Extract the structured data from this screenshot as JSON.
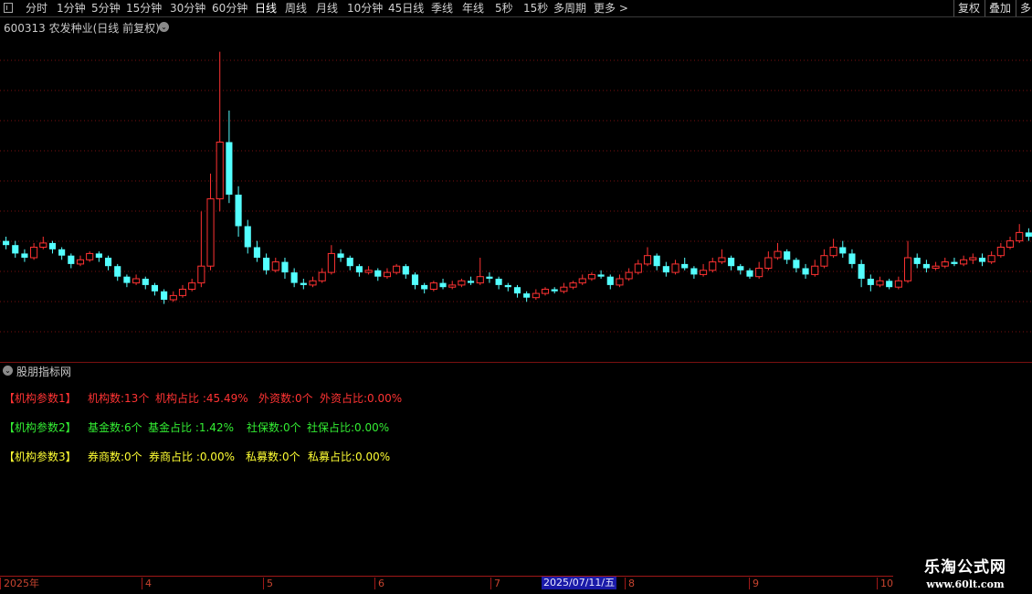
{
  "toolbar": {
    "periods": [
      "分时",
      "1分钟",
      "5分钟",
      "15分钟",
      "30分钟",
      "60分钟",
      "日线",
      "周线",
      "月线",
      "10分钟",
      "45日线",
      "季线",
      "年线",
      "5秒",
      "15秒",
      "多周期",
      "更多 >"
    ],
    "active_period": "日线",
    "right_buttons": [
      "复权",
      "叠加",
      "多"
    ]
  },
  "main_chart": {
    "title": "600313 农发种业(日线 前复权)",
    "colors": {
      "up": "#ff3232",
      "down": "#54ffff",
      "grid": "#7a1010"
    }
  },
  "indicator": {
    "title": "股朋指标网",
    "rows": [
      {
        "color": "#ff3333",
        "items": [
          "【机构参数1】",
          "机构数:13个",
          "机构占比 :45.49%",
          "外资数:0个",
          "外资占比:0.00%"
        ]
      },
      {
        "color": "#33ee33",
        "items": [
          "【机构参数2】",
          "基金数:6个",
          "基金占比 :1.42%",
          "社保数:0个",
          "社保占比:0.00%"
        ]
      },
      {
        "color": "#ffff33",
        "items": [
          "【机构参数3】",
          "券商数:0个",
          "券商占比 :0.00%",
          "私募数:0个",
          "私募占比:0.00%"
        ]
      }
    ]
  },
  "time_axis": {
    "labels": [
      "2025年",
      "4",
      "5",
      "6",
      "7",
      "8",
      "9",
      "10"
    ],
    "current": "2025/07/11/五"
  },
  "watermark": {
    "title": "乐淘公式网",
    "url": "www.60lt.com"
  },
  "chart_data": {
    "type": "candlestick",
    "title": "600313 农发种业(日线 前复权)",
    "candles": [
      [
        0.48,
        0.46,
        0.5,
        0.44
      ],
      [
        0.46,
        0.42,
        0.48,
        0.4
      ],
      [
        0.42,
        0.4,
        0.44,
        0.38
      ],
      [
        0.4,
        0.45,
        0.47,
        0.39
      ],
      [
        0.45,
        0.47,
        0.5,
        0.44
      ],
      [
        0.47,
        0.44,
        0.48,
        0.42
      ],
      [
        0.44,
        0.41,
        0.45,
        0.39
      ],
      [
        0.41,
        0.37,
        0.42,
        0.35
      ],
      [
        0.37,
        0.39,
        0.41,
        0.36
      ],
      [
        0.39,
        0.42,
        0.43,
        0.38
      ],
      [
        0.42,
        0.4,
        0.43,
        0.38
      ],
      [
        0.4,
        0.36,
        0.41,
        0.34
      ],
      [
        0.36,
        0.31,
        0.37,
        0.29
      ],
      [
        0.31,
        0.28,
        0.32,
        0.26
      ],
      [
        0.28,
        0.3,
        0.32,
        0.27
      ],
      [
        0.3,
        0.27,
        0.31,
        0.25
      ],
      [
        0.27,
        0.24,
        0.28,
        0.22
      ],
      [
        0.24,
        0.2,
        0.25,
        0.18
      ],
      [
        0.2,
        0.22,
        0.24,
        0.19
      ],
      [
        0.22,
        0.25,
        0.27,
        0.21
      ],
      [
        0.25,
        0.28,
        0.3,
        0.24
      ],
      [
        0.28,
        0.36,
        0.62,
        0.26
      ],
      [
        0.36,
        0.68,
        0.8,
        0.34
      ],
      [
        0.68,
        0.95,
        1.38,
        0.62
      ],
      [
        0.95,
        0.7,
        1.1,
        0.66
      ],
      [
        0.7,
        0.55,
        0.74,
        0.5
      ],
      [
        0.55,
        0.45,
        0.58,
        0.42
      ],
      [
        0.45,
        0.4,
        0.48,
        0.38
      ],
      [
        0.4,
        0.34,
        0.42,
        0.32
      ],
      [
        0.34,
        0.38,
        0.4,
        0.33
      ],
      [
        0.38,
        0.33,
        0.4,
        0.3
      ],
      [
        0.33,
        0.28,
        0.35,
        0.26
      ],
      [
        0.28,
        0.27,
        0.3,
        0.25
      ],
      [
        0.27,
        0.29,
        0.31,
        0.26
      ],
      [
        0.29,
        0.33,
        0.35,
        0.28
      ],
      [
        0.33,
        0.42,
        0.46,
        0.32
      ],
      [
        0.42,
        0.4,
        0.44,
        0.38
      ],
      [
        0.4,
        0.36,
        0.41,
        0.34
      ],
      [
        0.36,
        0.33,
        0.37,
        0.31
      ],
      [
        0.33,
        0.34,
        0.36,
        0.32
      ],
      [
        0.34,
        0.31,
        0.35,
        0.29
      ],
      [
        0.31,
        0.33,
        0.35,
        0.3
      ],
      [
        0.33,
        0.36,
        0.37,
        0.32
      ],
      [
        0.36,
        0.32,
        0.37,
        0.3
      ],
      [
        0.32,
        0.27,
        0.33,
        0.25
      ],
      [
        0.27,
        0.25,
        0.28,
        0.23
      ],
      [
        0.25,
        0.28,
        0.29,
        0.24
      ],
      [
        0.28,
        0.26,
        0.3,
        0.25
      ],
      [
        0.26,
        0.27,
        0.29,
        0.25
      ],
      [
        0.27,
        0.29,
        0.3,
        0.26
      ],
      [
        0.29,
        0.28,
        0.31,
        0.27
      ],
      [
        0.28,
        0.31,
        0.4,
        0.27
      ],
      [
        0.31,
        0.3,
        0.33,
        0.28
      ],
      [
        0.3,
        0.27,
        0.31,
        0.25
      ],
      [
        0.27,
        0.26,
        0.28,
        0.24
      ],
      [
        0.26,
        0.23,
        0.27,
        0.21
      ],
      [
        0.23,
        0.21,
        0.24,
        0.19
      ],
      [
        0.21,
        0.23,
        0.25,
        0.2
      ],
      [
        0.23,
        0.25,
        0.26,
        0.22
      ],
      [
        0.25,
        0.24,
        0.26,
        0.23
      ],
      [
        0.24,
        0.26,
        0.28,
        0.23
      ],
      [
        0.26,
        0.28,
        0.29,
        0.25
      ],
      [
        0.28,
        0.3,
        0.32,
        0.27
      ],
      [
        0.3,
        0.32,
        0.33,
        0.29
      ],
      [
        0.32,
        0.31,
        0.34,
        0.3
      ],
      [
        0.31,
        0.27,
        0.32,
        0.25
      ],
      [
        0.27,
        0.3,
        0.32,
        0.26
      ],
      [
        0.3,
        0.33,
        0.35,
        0.29
      ],
      [
        0.33,
        0.37,
        0.39,
        0.32
      ],
      [
        0.37,
        0.41,
        0.45,
        0.36
      ],
      [
        0.41,
        0.36,
        0.42,
        0.34
      ],
      [
        0.36,
        0.33,
        0.38,
        0.31
      ],
      [
        0.33,
        0.37,
        0.39,
        0.32
      ],
      [
        0.37,
        0.35,
        0.4,
        0.34
      ],
      [
        0.35,
        0.32,
        0.36,
        0.3
      ],
      [
        0.32,
        0.34,
        0.37,
        0.31
      ],
      [
        0.34,
        0.38,
        0.4,
        0.33
      ],
      [
        0.38,
        0.4,
        0.44,
        0.37
      ],
      [
        0.4,
        0.36,
        0.41,
        0.34
      ],
      [
        0.36,
        0.34,
        0.37,
        0.32
      ],
      [
        0.34,
        0.31,
        0.35,
        0.3
      ],
      [
        0.31,
        0.35,
        0.38,
        0.3
      ],
      [
        0.35,
        0.4,
        0.43,
        0.34
      ],
      [
        0.4,
        0.43,
        0.47,
        0.39
      ],
      [
        0.43,
        0.39,
        0.44,
        0.37
      ],
      [
        0.39,
        0.35,
        0.4,
        0.33
      ],
      [
        0.35,
        0.32,
        0.37,
        0.3
      ],
      [
        0.32,
        0.36,
        0.39,
        0.31
      ],
      [
        0.36,
        0.41,
        0.44,
        0.35
      ],
      [
        0.41,
        0.45,
        0.49,
        0.4
      ],
      [
        0.45,
        0.42,
        0.48,
        0.4
      ],
      [
        0.42,
        0.37,
        0.44,
        0.35
      ],
      [
        0.37,
        0.3,
        0.39,
        0.26
      ],
      [
        0.3,
        0.27,
        0.32,
        0.24
      ],
      [
        0.27,
        0.29,
        0.31,
        0.26
      ],
      [
        0.29,
        0.26,
        0.3,
        0.25
      ],
      [
        0.26,
        0.29,
        0.31,
        0.25
      ],
      [
        0.29,
        0.4,
        0.48,
        0.28
      ],
      [
        0.4,
        0.37,
        0.42,
        0.35
      ],
      [
        0.37,
        0.35,
        0.39,
        0.33
      ],
      [
        0.35,
        0.36,
        0.38,
        0.34
      ],
      [
        0.36,
        0.38,
        0.4,
        0.35
      ],
      [
        0.38,
        0.37,
        0.4,
        0.36
      ],
      [
        0.37,
        0.39,
        0.41,
        0.36
      ],
      [
        0.39,
        0.4,
        0.42,
        0.37
      ],
      [
        0.4,
        0.38,
        0.42,
        0.36
      ],
      [
        0.38,
        0.41,
        0.43,
        0.37
      ],
      [
        0.41,
        0.45,
        0.47,
        0.4
      ],
      [
        0.45,
        0.48,
        0.5,
        0.44
      ],
      [
        0.48,
        0.52,
        0.56,
        0.47
      ],
      [
        0.52,
        0.5,
        0.54,
        0.48
      ]
    ]
  }
}
